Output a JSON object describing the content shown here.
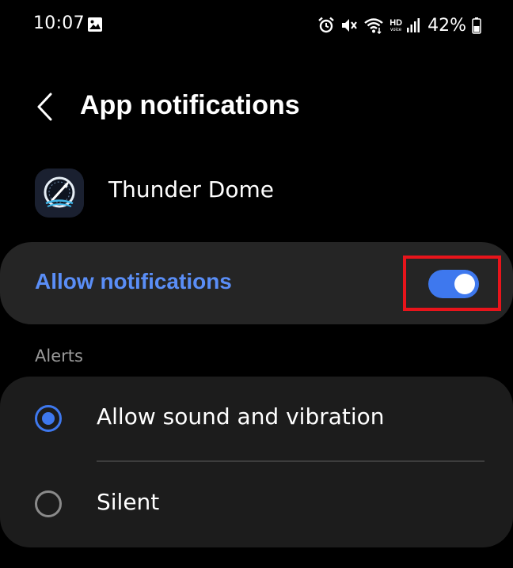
{
  "status_bar": {
    "time": "10:07",
    "hd_label": "HD",
    "voice_label": "voice",
    "battery_percent": "42%"
  },
  "header": {
    "title": "App notifications",
    "back_icon": "chevron-left-icon"
  },
  "app": {
    "name": "Thunder Dome",
    "icon": "thunder-dome-app-icon"
  },
  "allow_notifications": {
    "label": "Allow notifications",
    "enabled": true
  },
  "alerts": {
    "section_label": "Alerts",
    "options": [
      {
        "label": "Allow sound and vibration",
        "selected": true
      },
      {
        "label": "Silent",
        "selected": false
      }
    ]
  },
  "colors": {
    "accent": "#3e78ee",
    "accent_text": "#5a8ef7",
    "highlight": "#e8141b",
    "card": "#252525"
  }
}
